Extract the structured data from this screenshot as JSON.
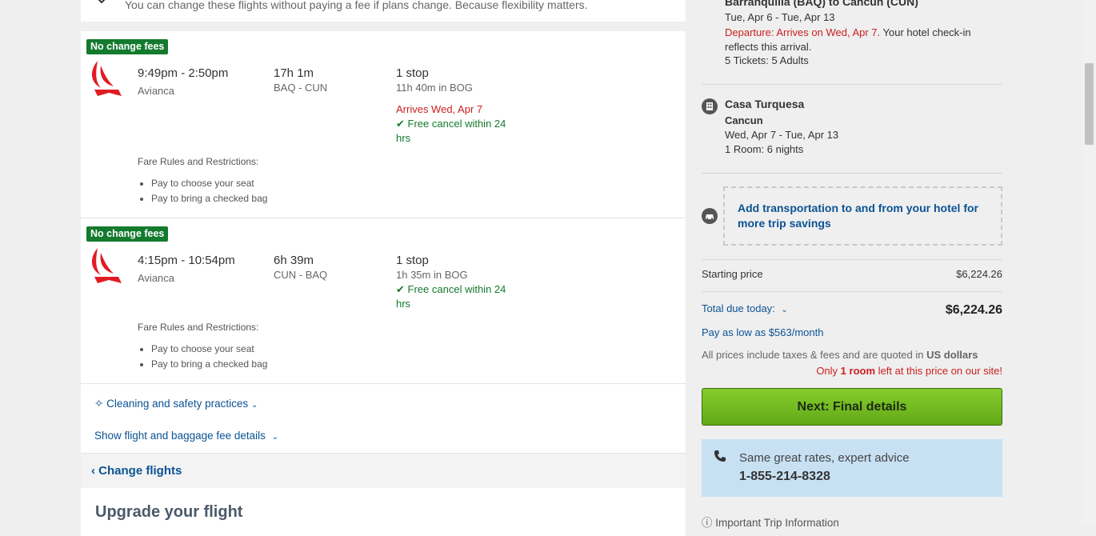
{
  "top_note": {
    "text": "You can change these flights without paying a fee if plans change. Because flexibility matters."
  },
  "flights": [
    {
      "badge": "No change fees",
      "times": "9:49pm - 2:50pm",
      "airline": "Avianca",
      "duration": "17h 1m",
      "route": "BAQ - CUN",
      "stops": "1 stop",
      "layover": "11h 40m in BOG",
      "arrives": "Arrives Wed, Apr 7",
      "cancel": "Free cancel within 24 hrs",
      "fare_title": "Fare Rules and Restrictions:",
      "fare_rules": [
        "Pay to choose your seat",
        "Pay to bring a checked bag"
      ]
    },
    {
      "badge": "No change fees",
      "times": "4:15pm - 10:54pm",
      "airline": "Avianca",
      "duration": "6h 39m",
      "route": "CUN - BAQ",
      "stops": "1 stop",
      "layover": "1h 35m in BOG",
      "cancel": "Free cancel within 24 hrs",
      "fare_title": "Fare Rules and Restrictions:",
      "fare_rules": [
        "Pay to choose your seat",
        "Pay to bring a checked bag"
      ]
    }
  ],
  "links": {
    "cleaning": "Cleaning and safety practices",
    "baggage": "Show flight and baggage fee details",
    "change_flights": "Change flights"
  },
  "upgrade": {
    "title": "Upgrade your flight"
  },
  "summary": {
    "flight_title": "Barranquilla (BAQ) to Cancun (CUN)",
    "flight_dates": "Tue, Apr 6 - Tue, Apr 13",
    "departure_prefix": "Departure: Arrives on Wed, Apr 7.",
    "departure_suffix": "Your hotel check-in reflects this arrival.",
    "tickets": "5 Tickets: 5 Adults",
    "hotel_name": "Casa Turquesa",
    "hotel_city": "Cancun",
    "hotel_dates": "Wed, Apr 7 - Tue, Apr 13",
    "hotel_rooms": "1 Room: 6 nights",
    "transport": "Add transportation to and from your hotel for more trip savings",
    "starting_label": "Starting price",
    "starting_price": "$6,224.26",
    "total_label": "Total due today:",
    "total_price": "$6,224.26",
    "pay_low": "Pay as low as $563/month",
    "prices_note_prefix": "All prices include taxes & fees and are quoted in",
    "prices_note_currency": "US dollars",
    "only_prefix": "Only",
    "only_bold": "1 room",
    "only_suffix": "left at this price on our site!",
    "next_button": "Next: Final details",
    "rates_text": "Same great rates, expert advice",
    "phone": "1-855-214-8328",
    "important": "Important Trip Information"
  },
  "colors": {
    "badge_green": "#137a2e",
    "link_blue": "#0b5394",
    "alert_red": "#cc1f1f",
    "button_green": "#6fb51f",
    "phone_box_blue": "#c7e1f3"
  }
}
